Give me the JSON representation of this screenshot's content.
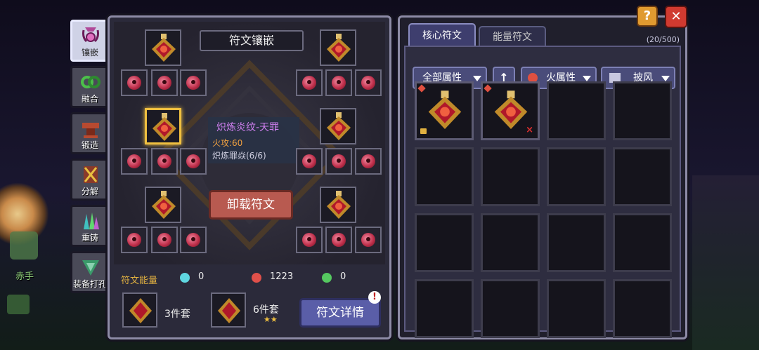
{
  "side_tabs": [
    {
      "label": "镶嵌",
      "icon": "inlay-icon",
      "active": true
    },
    {
      "label": "融合",
      "icon": "fusion-icon",
      "active": false
    },
    {
      "label": "锻造",
      "icon": "anvil-icon",
      "active": false
    },
    {
      "label": "分解",
      "icon": "decompose-icon",
      "active": false
    },
    {
      "label": "重铸",
      "icon": "recast-icon",
      "active": false
    },
    {
      "label": "装备打孔",
      "icon": "punch-icon",
      "active": false
    }
  ],
  "left_panel": {
    "title": "符文镶嵌",
    "tooltip": {
      "name": "炽炼炎纹-天罪",
      "stat": "火攻:60",
      "set": "炽炼罪焱(6/6)"
    },
    "unequip_label": "卸载符文",
    "energy_label": "符文能量",
    "energy": [
      {
        "icon": "cyan-gem-icon",
        "value": "0",
        "color": "#5fd6e0"
      },
      {
        "icon": "fire-gem-icon",
        "value": "1223",
        "color": "#e0504a"
      },
      {
        "icon": "green-gem-icon",
        "value": "0",
        "color": "#55c860"
      }
    ],
    "sets": [
      {
        "label": "3件套",
        "stars": ""
      },
      {
        "label": "6件套",
        "stars": "★★"
      }
    ],
    "detail_label": "符文详情",
    "notice": "!"
  },
  "right_panel": {
    "tabs": [
      {
        "label": "核心符文",
        "active": true
      },
      {
        "label": "能量符文",
        "active": false
      }
    ],
    "count": "(20/500)",
    "filters": {
      "all": "全部属性",
      "sort_icon": "arrow-up-icon",
      "element": "火属性",
      "slot": "披风"
    },
    "items": [
      {
        "locked": true,
        "equipped": false
      },
      {
        "locked": false,
        "equipped": true
      }
    ]
  },
  "top_buttons": {
    "help": "?",
    "close": "✕"
  },
  "background": {
    "hero_label": "赤手"
  }
}
